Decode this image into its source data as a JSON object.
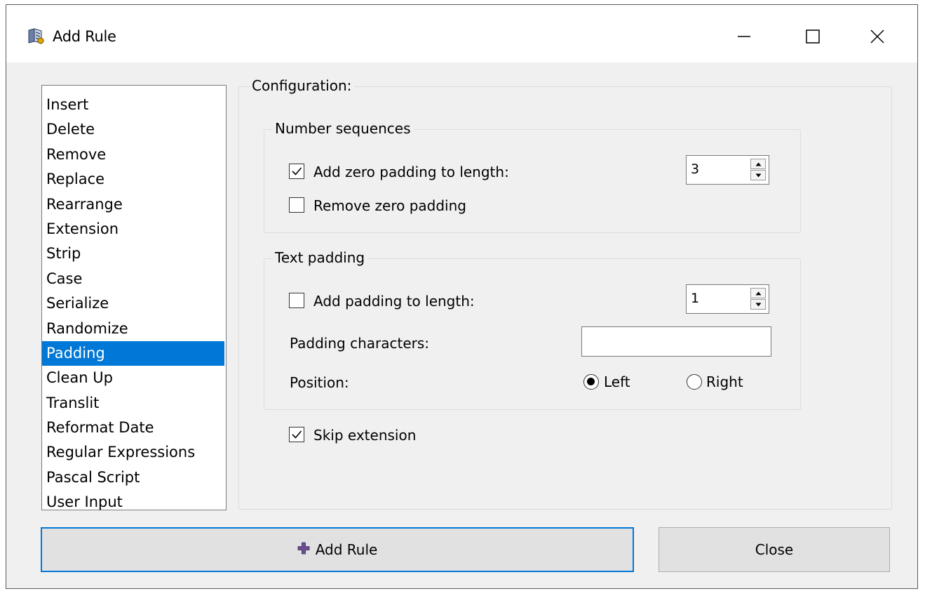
{
  "window": {
    "title": "Add Rule",
    "controls": [
      "minimize",
      "maximize",
      "close"
    ]
  },
  "rules": {
    "items": [
      {
        "label": "Insert"
      },
      {
        "label": "Delete"
      },
      {
        "label": "Remove"
      },
      {
        "label": "Replace"
      },
      {
        "label": "Rearrange"
      },
      {
        "label": "Extension"
      },
      {
        "label": "Strip"
      },
      {
        "label": "Case"
      },
      {
        "label": "Serialize"
      },
      {
        "label": "Randomize"
      },
      {
        "label": "Padding",
        "selected": true
      },
      {
        "label": "Clean Up"
      },
      {
        "label": "Translit"
      },
      {
        "label": "Reformat Date"
      },
      {
        "label": "Regular Expressions"
      },
      {
        "label": "Pascal Script"
      },
      {
        "label": "User Input"
      }
    ],
    "selected": "Padding"
  },
  "config": {
    "title": "Configuration:",
    "number_sequences": {
      "title": "Number sequences",
      "add_zero_padding": {
        "label": "Add zero padding to length:",
        "checked": true,
        "value": "3"
      },
      "remove_zero_padding": {
        "label": "Remove zero padding",
        "checked": false
      }
    },
    "text_padding": {
      "title": "Text padding",
      "add_padding": {
        "label": "Add padding to length:",
        "checked": false,
        "value": "1"
      },
      "padding_characters": {
        "label": "Padding characters:",
        "value": ""
      },
      "position": {
        "label": "Position:",
        "options": [
          {
            "label": "Left",
            "selected": true
          },
          {
            "label": "Right",
            "selected": false
          }
        ]
      }
    },
    "skip_extension": {
      "label": "Skip extension",
      "checked": true
    }
  },
  "buttons": {
    "add_rule": "Add Rule",
    "close": "Close"
  },
  "colors": {
    "selection": "#0078d7",
    "window_bg": "#f0f0f0",
    "add_icon": "#6b4e8f"
  },
  "icons": {
    "app": "rule-book-icon",
    "add": "plus-icon"
  }
}
